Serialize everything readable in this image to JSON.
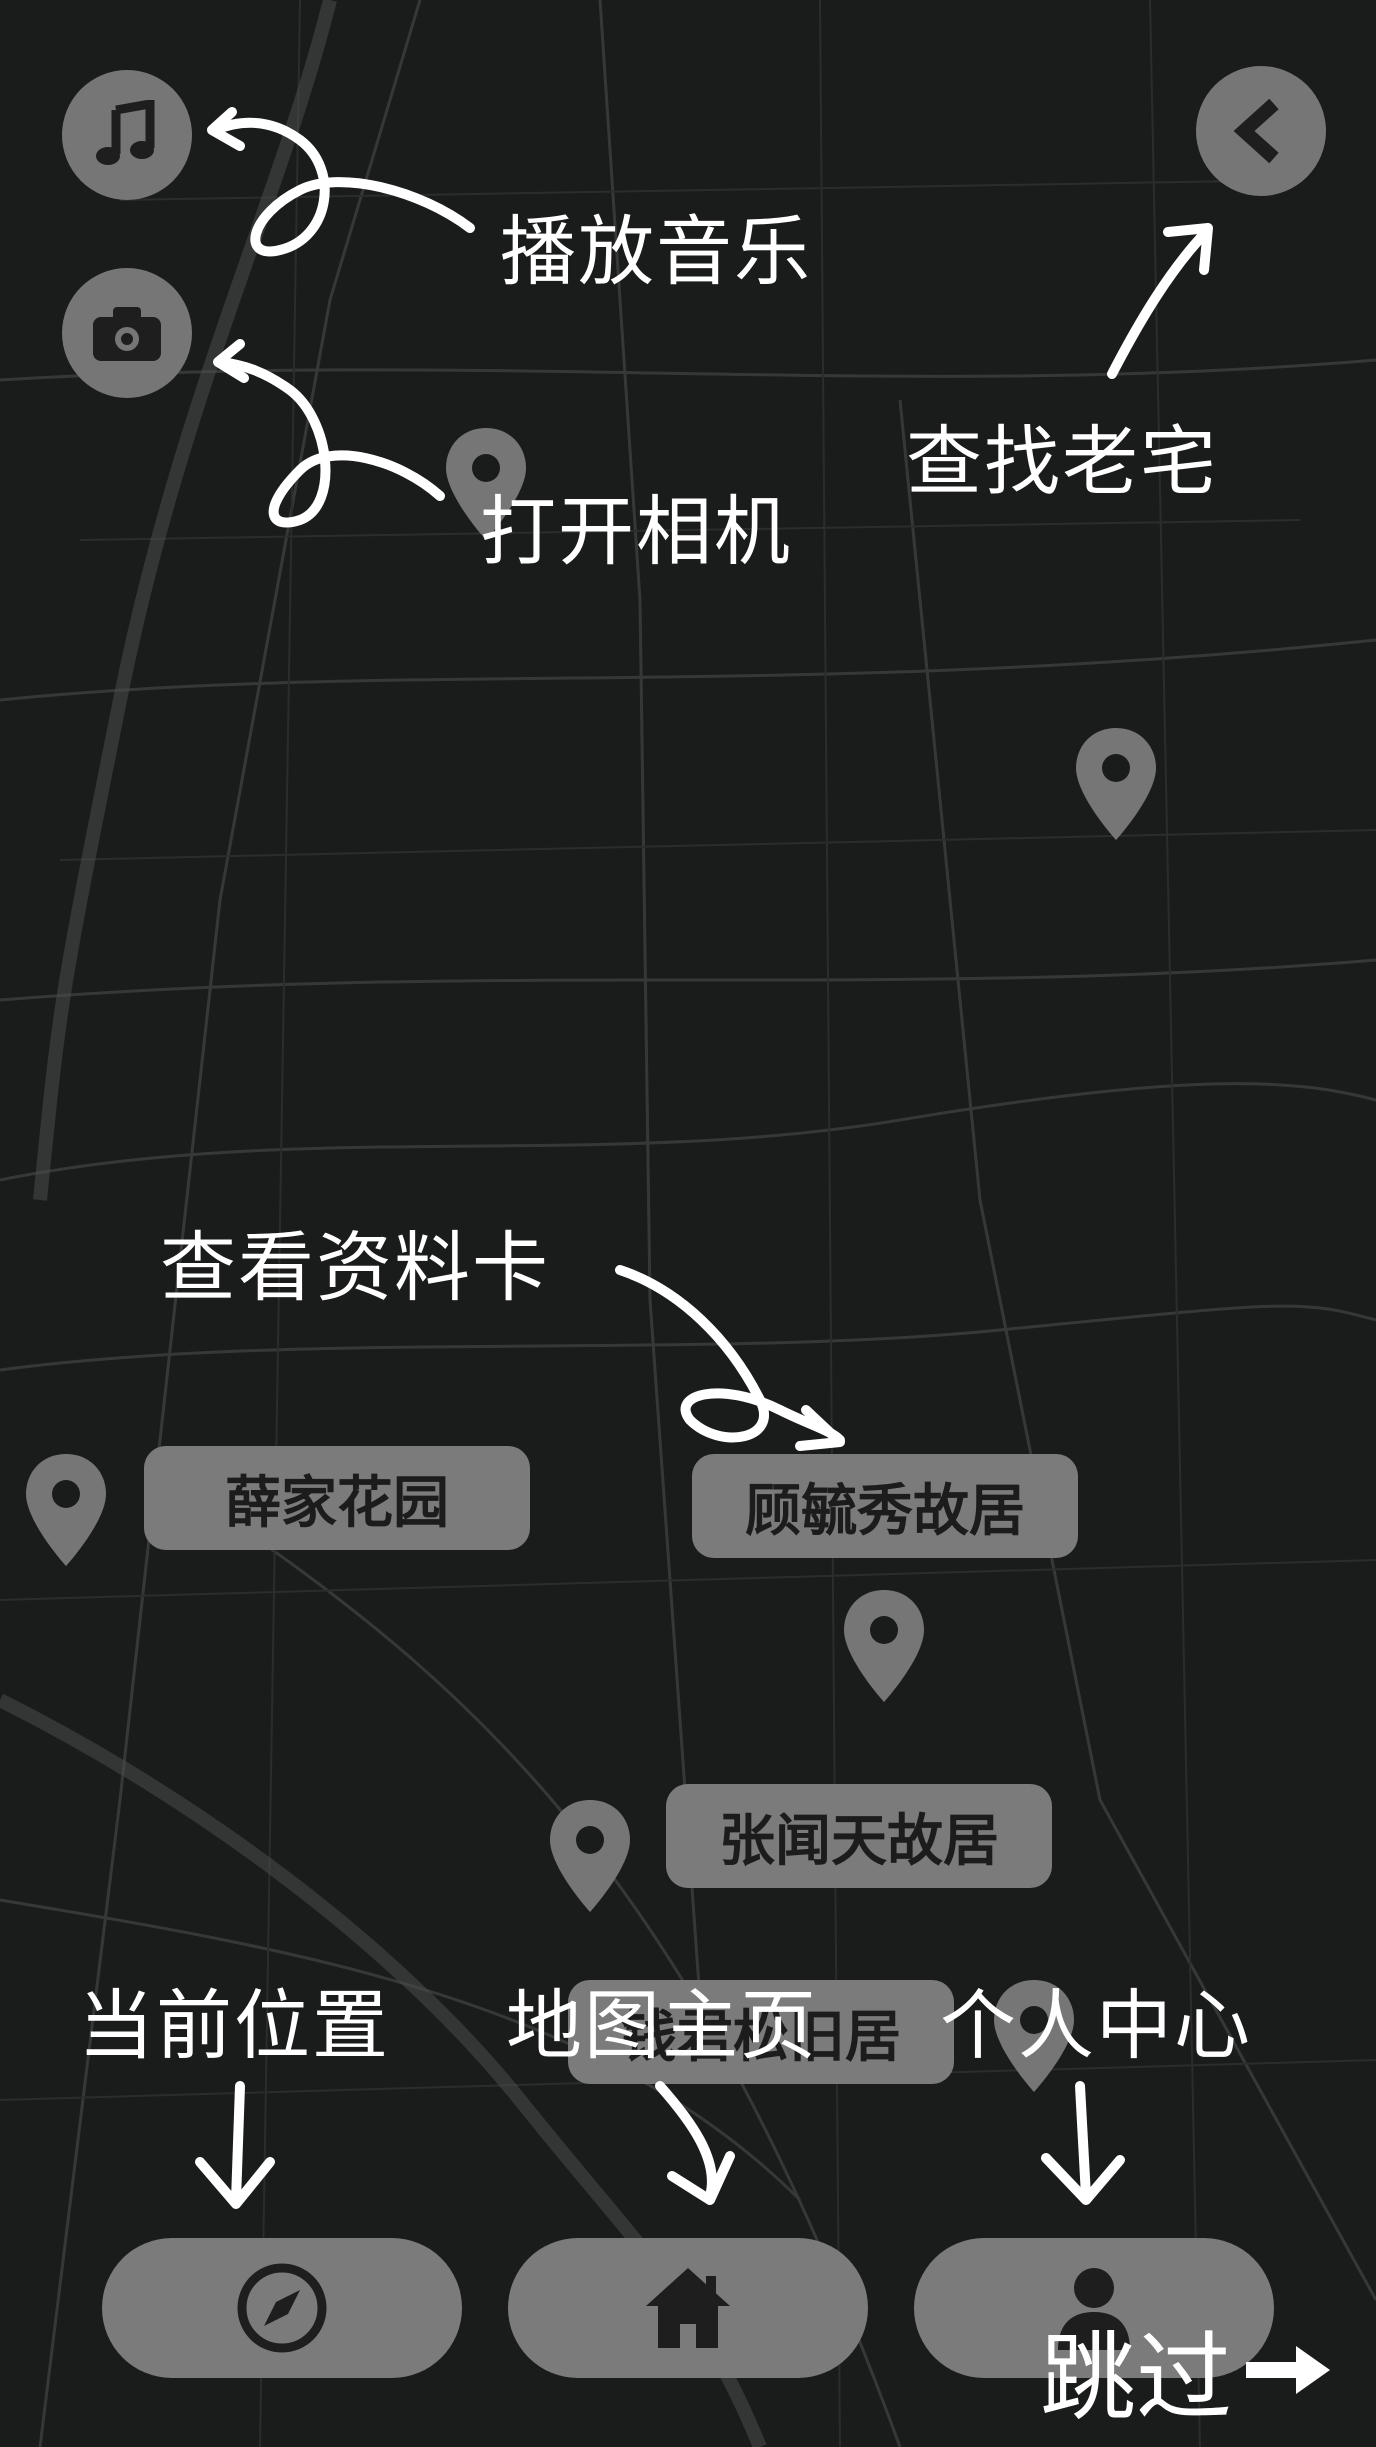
{
  "colors": {
    "background": "#1a1b1b",
    "button": "#767676",
    "label_card": "#7b7b7b",
    "label_text": "#1c1c1c",
    "hint_text": "#ffffff"
  },
  "top_buttons": {
    "music_icon": "music-note-icon",
    "camera_icon": "camera-icon",
    "back_icon": "chevron-left-icon"
  },
  "hints": {
    "play_music": "播放音乐",
    "open_camera": "打开相机",
    "find_house": "查找老宅",
    "view_card": "查看资料卡",
    "current_location": "当前位置",
    "map_home": "地图主页",
    "personal_center": "个人中心"
  },
  "places": [
    {
      "name": "薛家花园"
    },
    {
      "name": "顾毓秀故居"
    },
    {
      "name": "张闻天故居"
    },
    {
      "name": "钱君松旧居"
    }
  ],
  "bottom_nav": {
    "location_icon": "compass-icon",
    "home_icon": "home-icon",
    "profile_icon": "user-icon"
  },
  "skip": {
    "label": "跳过",
    "icon": "right-arrow-icon"
  }
}
